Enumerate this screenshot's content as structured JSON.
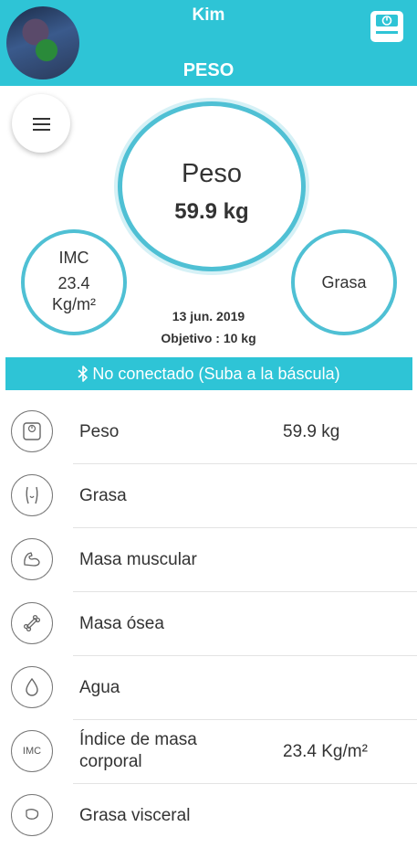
{
  "header": {
    "user_name": "Kim",
    "page_title": "PESO",
    "color": "#2ec4d6"
  },
  "summary": {
    "main_label": "Peso",
    "main_value": "59.9 kg",
    "imc_label": "IMC",
    "imc_value": "23.4",
    "imc_unit": "Kg/m²",
    "fat_label": "Grasa",
    "date": "13 jun. 2019",
    "objective": "Objetivo : 10 kg"
  },
  "connection": {
    "icon": "bluetooth-icon",
    "text": "No conectado (Suba a la báscula)"
  },
  "list": [
    {
      "icon": "scale-icon",
      "label": "Peso",
      "value": "59.9 kg"
    },
    {
      "icon": "body-fat-icon",
      "label": "Grasa",
      "value": ""
    },
    {
      "icon": "muscle-icon",
      "label": "Masa muscular",
      "value": ""
    },
    {
      "icon": "bone-icon",
      "label": "Masa ósea",
      "value": ""
    },
    {
      "icon": "water-drop-icon",
      "label": "Agua",
      "value": ""
    },
    {
      "icon": "imc-icon",
      "icon_text": "IMC",
      "label_line1": "Índice de masa",
      "label_line2": "corporal",
      "value": "23.4 Kg/m²"
    },
    {
      "icon": "visceral-fat-icon",
      "label": "Grasa visceral",
      "value": ""
    }
  ]
}
